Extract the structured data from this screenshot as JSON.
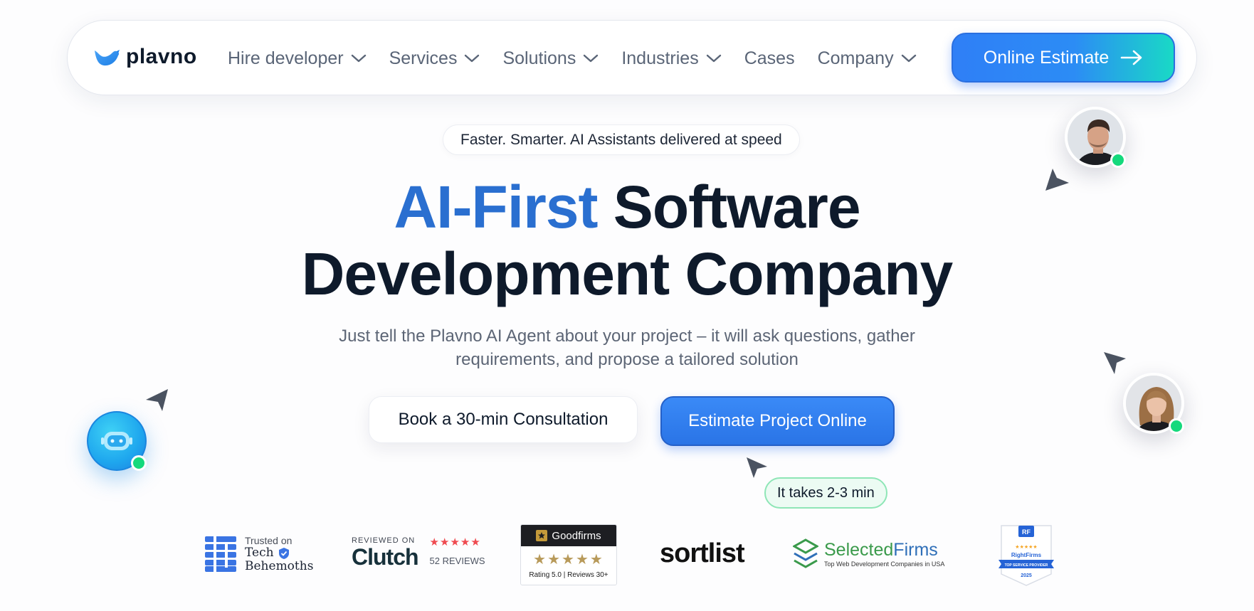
{
  "nav": {
    "logo_text": "plavno",
    "items": [
      {
        "label": "Hire developer",
        "has_dropdown": true
      },
      {
        "label": "Services",
        "has_dropdown": true
      },
      {
        "label": "Solutions",
        "has_dropdown": true
      },
      {
        "label": "Industries",
        "has_dropdown": true
      },
      {
        "label": "Cases",
        "has_dropdown": false
      },
      {
        "label": "Company",
        "has_dropdown": true
      }
    ],
    "cta_label": "Online Estimate"
  },
  "hero": {
    "tagline": "Faster. Smarter. AI Assistants delivered at speed",
    "title_accent": "AI-First",
    "title_rest_line1": "Software",
    "title_line2": "Development Company",
    "subtitle_line1": "Just tell the Plavno AI Agent about your project – it will ask questions, gather",
    "subtitle_line2": "requirements, and propose a tailored solution",
    "secondary_button": "Book a 30-min Consultation",
    "primary_button": "Estimate Project Online",
    "time_note": "It takes 2-3 min"
  },
  "badges": {
    "techbehemoths": {
      "trusted": "Trusted on",
      "name_line1": "Tech",
      "name_line2": "Behemoths"
    },
    "clutch": {
      "reviewed": "REVIEWED ON",
      "name": "Clutch",
      "reviews": "52 REVIEWS",
      "stars": "★★★★★"
    },
    "goodfirms": {
      "name": "Goodfirms",
      "stars": "★★★★★",
      "rating": "Rating 5.0 | Reviews 30+"
    },
    "sortlist": {
      "name": "sortlist"
    },
    "selectedfirms": {
      "name_a": "Selected",
      "name_b": "Firms",
      "sub": "Top Web Development Companies in USA"
    },
    "rightfirms": {
      "name": "RightFirms",
      "banner": "TOP SERVICE PROVIDER",
      "year": "2025"
    }
  },
  "colors": {
    "accent_blue": "#2a6fd0",
    "button_blue": "#2f7ff6",
    "teal": "#19d9c6",
    "online_green": "#14d97c",
    "dark_text": "#0e1a2b"
  }
}
